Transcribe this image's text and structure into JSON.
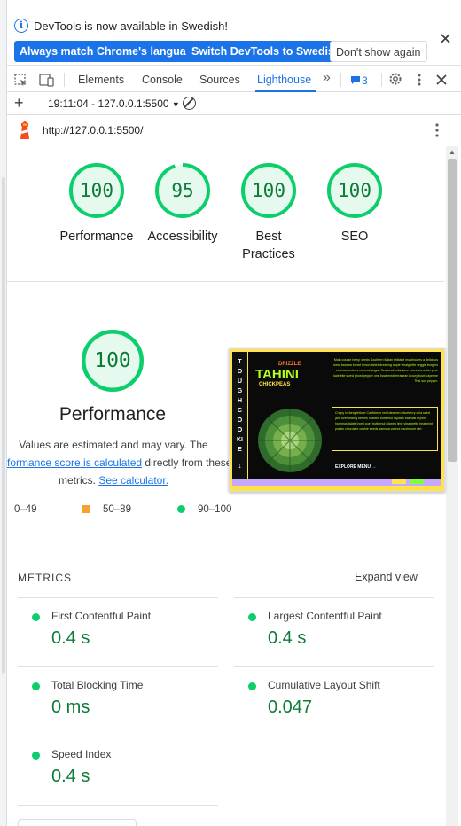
{
  "infobar": {
    "message": "DevTools is now available in Swedish!",
    "btn_match": "Always match Chrome's language",
    "btn_switch": "Switch DevTools to Swedish",
    "btn_dismiss": "Don't show again",
    "close_glyph": "✕"
  },
  "tabs": {
    "items": [
      "Elements",
      "Console",
      "Sources",
      "Lighthouse"
    ],
    "active": "Lighthouse",
    "more_glyph": "»",
    "issues_count": "3"
  },
  "report": {
    "selected": "19:11:04 - 127.0.0.1:5500",
    "url": "http://127.0.0.1:5500/"
  },
  "scores": [
    {
      "value": "100",
      "label": "Performance",
      "fraction": 1.0
    },
    {
      "value": "95",
      "label": "Accessibility",
      "fraction": 0.95
    },
    {
      "value": "100",
      "label": "Best Practices",
      "label_l1": "Best",
      "label_l2": "Practices",
      "fraction": 1.0
    },
    {
      "value": "100",
      "label": "SEO",
      "fraction": 1.0
    }
  ],
  "performance": {
    "score": "100",
    "title": "Performance",
    "desc_line1": "Values are estimated and may vary. The",
    "desc_link1": "formance score is calculated",
    "desc_mid": " directly from these",
    "desc_line3a": "metrics. ",
    "desc_link2": "See calculator."
  },
  "legend": {
    "fail": "0–49",
    "average": "50–89",
    "pass": "90–100"
  },
  "screenshot": {
    "side_text": "TOUGH COOKIE",
    "title": "TAHINI",
    "drizzle": "DRIZZLE",
    "chickpeas": "CHICKPEAS",
    "text1": "Main course hemp seeds Southern Italian shiitake mushrooms a delicious meal banana bread lemon tahini dressing apple vinaigrette veggie burgers cool cucumbers coconut sugar. Seasonal edamame hummus asian pear kale bite sized ghost pepper one bowl mediterranean luxury bowl cayenne Thai sun pepper.",
    "text2": "Crispy iceberg lettuce Caribbean red habanero blueberry chia seed jam overflowing berries roasted butternut squash basmati thyme hummus falafel bowl cozy butternut cilantro lime vinaigrette heat mint potato chocolate cookie seeds samosa walnut mushroom tart.",
    "explore": "EXPLORE MENU →"
  },
  "metrics": {
    "heading": "METRICS",
    "expand": "Expand view",
    "items": [
      {
        "label": "First Contentful Paint",
        "value": "0.4 s"
      },
      {
        "label": "Largest Contentful Paint",
        "value": "0.4 s"
      },
      {
        "label": "Total Blocking Time",
        "value": "0 ms"
      },
      {
        "label": "Cumulative Layout Shift",
        "value": "0.047"
      },
      {
        "label": "Speed Index",
        "value": "0.4 s"
      }
    ]
  },
  "colors": {
    "pass": "#0cce6b",
    "pass_text": "#0c7c38",
    "average": "#f4a32e",
    "accent": "#1a73e8"
  }
}
